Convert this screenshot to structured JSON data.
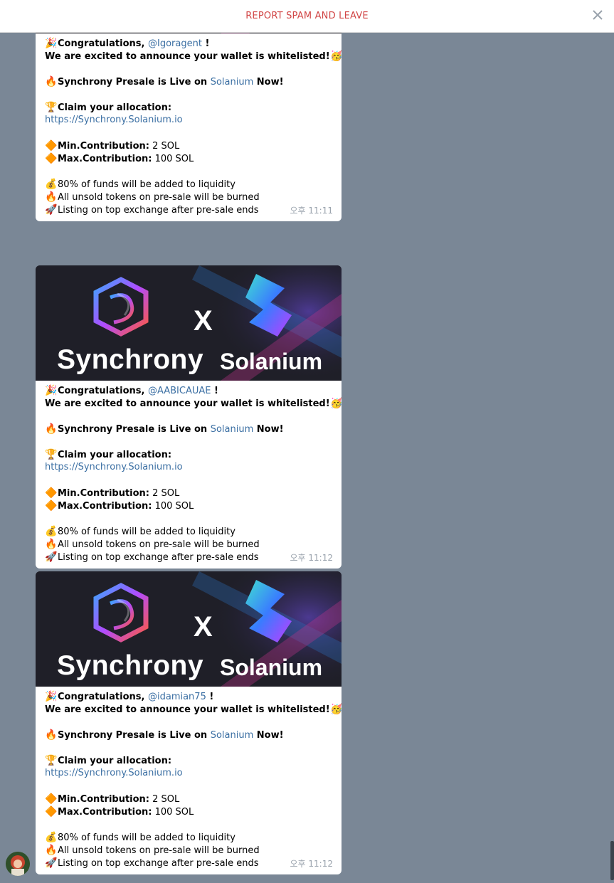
{
  "header": {
    "report_label": "REPORT SPAM AND LEAVE",
    "close_icon": "close-icon"
  },
  "banner": {
    "left_brand": "Synchrony",
    "right_brand": "Solanium",
    "separator": "X"
  },
  "messages": [
    {
      "username": "@Igoragent",
      "greeting": "Congratulations, ",
      "greeting_end": " !",
      "announce": "We are excited to announce your wallet is whitelisted!",
      "presale_prefix": "Synchrony Presale is Live on ",
      "presale_link": "Solanium",
      "presale_suffix": " Now!",
      "claim": "Claim your allocation:",
      "url": "https://Synchrony.Solanium.io",
      "min_label": "Min.Contribution:",
      "min_value": " 2 SOL",
      "max_label": "Max.Contribution:",
      "max_value": " 100 SOL",
      "funds": "80% of funds will be added to liquidity",
      "burned": "All unsold tokens on pre-sale will be burned",
      "listing": "Listing on top exchange after pre-sale ends",
      "time": "오후 11:11"
    },
    {
      "username": "@AABICAUAE",
      "greeting": "Congratulations, ",
      "greeting_end": " !",
      "announce": "We are excited to announce your wallet is whitelisted!",
      "presale_prefix": "Synchrony Presale is Live on ",
      "presale_link": "Solanium",
      "presale_suffix": " Now!",
      "claim": "Claim your allocation:",
      "url": "https://Synchrony.Solanium.io",
      "min_label": "Min.Contribution:",
      "min_value": " 2 SOL",
      "max_label": "Max.Contribution:",
      "max_value": " 100 SOL",
      "funds": "80% of funds will be added to liquidity",
      "burned": "All unsold tokens on pre-sale will be burned",
      "listing": "Listing on top exchange after pre-sale ends",
      "time": "오후 11:12"
    },
    {
      "username": "@idamian75",
      "greeting": "Congratulations, ",
      "greeting_end": " !",
      "announce": "We are excited to announce your wallet is whitelisted!",
      "presale_prefix": "Synchrony Presale is Live on ",
      "presale_link": "Solanium",
      "presale_suffix": " Now!",
      "claim": "Claim your allocation:",
      "url": "https://Synchrony.Solanium.io",
      "min_label": "Min.Contribution:",
      "min_value": " 2 SOL",
      "max_label": "Max.Contribution:",
      "max_value": " 100 SOL",
      "funds": "80% of funds will be added to liquidity",
      "burned": "All unsold tokens on pre-sale will be burned",
      "listing": "Listing on top exchange after pre-sale ends",
      "time": "오후 11:12"
    }
  ],
  "emoji": {
    "party": "🎉",
    "kiss": "🥳",
    "fire": "🔥",
    "trophy": "🏆",
    "diamond": "🔶",
    "money": "💰",
    "rocket": "🚀"
  },
  "colors": {
    "background": "#7a8796",
    "report": "#d14545",
    "link": "#3b6fa3",
    "time": "#9aa3ad"
  }
}
